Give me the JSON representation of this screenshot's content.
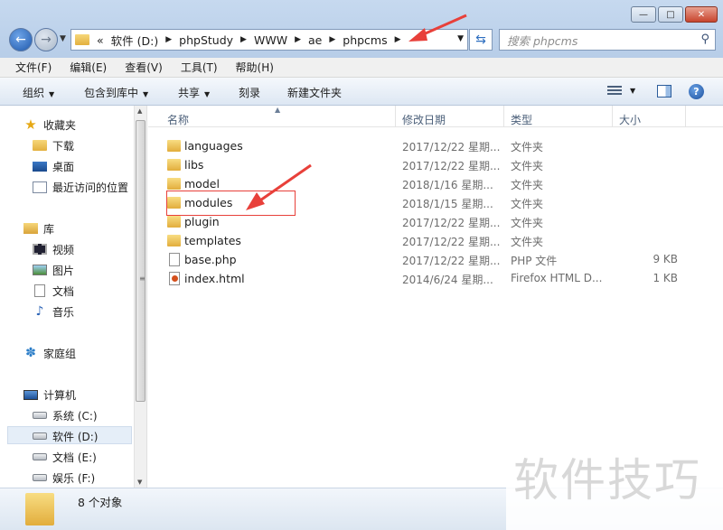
{
  "window": {
    "minimize": "—",
    "maximize": "□",
    "close": "✕"
  },
  "address": {
    "overflow": "«",
    "segments": [
      "软件 (D:)",
      "phpStudy",
      "WWW",
      "ae",
      "phpcms"
    ],
    "search_placeholder": "搜索 phpcms"
  },
  "menu": [
    "文件(F)",
    "编辑(E)",
    "查看(V)",
    "工具(T)",
    "帮助(H)"
  ],
  "toolbar": {
    "organize": "组织",
    "include_in_library": "包含到库中",
    "share": "共享",
    "burn": "刻录",
    "new_folder": "新建文件夹"
  },
  "nav": {
    "favorites": "收藏夹",
    "downloads": "下载",
    "desktop": "桌面",
    "recent": "最近访问的位置",
    "libraries": "库",
    "videos": "视频",
    "pictures": "图片",
    "documents": "文档",
    "music": "音乐",
    "homegroup": "家庭组",
    "computer": "计算机",
    "drive_c": "系统 (C:)",
    "drive_d": "软件 (D:)",
    "drive_e": "文档 (E:)",
    "drive_f": "娱乐 (F:)"
  },
  "columns": {
    "name": "名称",
    "modified": "修改日期",
    "type": "类型",
    "size": "大小"
  },
  "files": [
    {
      "name": "languages",
      "modified": "2017/12/22 星期...",
      "type": "文件夹",
      "size": "",
      "icon": "folder"
    },
    {
      "name": "libs",
      "modified": "2017/12/22 星期...",
      "type": "文件夹",
      "size": "",
      "icon": "folder"
    },
    {
      "name": "model",
      "modified": "2018/1/16 星期...",
      "type": "文件夹",
      "size": "",
      "icon": "folder"
    },
    {
      "name": "modules",
      "modified": "2018/1/15 星期...",
      "type": "文件夹",
      "size": "",
      "icon": "folder"
    },
    {
      "name": "plugin",
      "modified": "2017/12/22 星期...",
      "type": "文件夹",
      "size": "",
      "icon": "folder"
    },
    {
      "name": "templates",
      "modified": "2017/12/22 星期...",
      "type": "文件夹",
      "size": "",
      "icon": "folder"
    },
    {
      "name": "base.php",
      "modified": "2017/12/22 星期...",
      "type": "PHP 文件",
      "size": "9 KB",
      "icon": "file"
    },
    {
      "name": "index.html",
      "modified": "2014/6/24 星期...",
      "type": "Firefox HTML D...",
      "size": "1 KB",
      "icon": "html"
    }
  ],
  "status": {
    "count": "8 个对象"
  },
  "watermark": "软件技巧",
  "colors": {
    "annotation": "#e8403a",
    "accent": "#2c5d9b"
  }
}
